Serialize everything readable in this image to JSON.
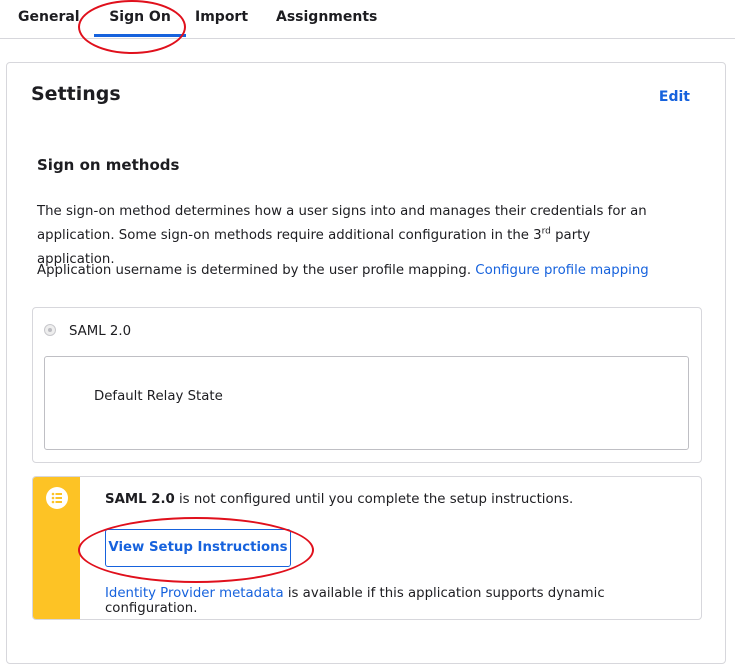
{
  "tabs": [
    {
      "label": "General",
      "active": false
    },
    {
      "label": "Sign On",
      "active": true
    },
    {
      "label": "Import",
      "active": false
    },
    {
      "label": "Assignments",
      "active": false
    }
  ],
  "settings": {
    "title": "Settings",
    "edit_label": "Edit"
  },
  "sign_on_methods": {
    "title": "Sign on methods",
    "description_part1": "The sign-on method determines how a user signs into and manages their credentials for an application. Some sign-on methods require additional configuration in the 3",
    "description_sup": "rd",
    "description_part2": " party application.",
    "username_text": "Application username is determined by the user profile mapping.",
    "profile_mapping_link": "Configure profile mapping"
  },
  "method": {
    "label": "SAML 2.0",
    "relay_state_label": "Default Relay State"
  },
  "notice": {
    "icon": "list-icon",
    "method_name": "SAML 2.0",
    "message": " is not configured until you complete the setup instructions.",
    "button_label": "View Setup Instructions",
    "metadata_link": "Identity Provider metadata",
    "metadata_text": " is available if this application supports dynamic configuration."
  },
  "colors": {
    "accent": "#1662dd",
    "warning": "#fdc325",
    "annotation": "#e0101c"
  }
}
